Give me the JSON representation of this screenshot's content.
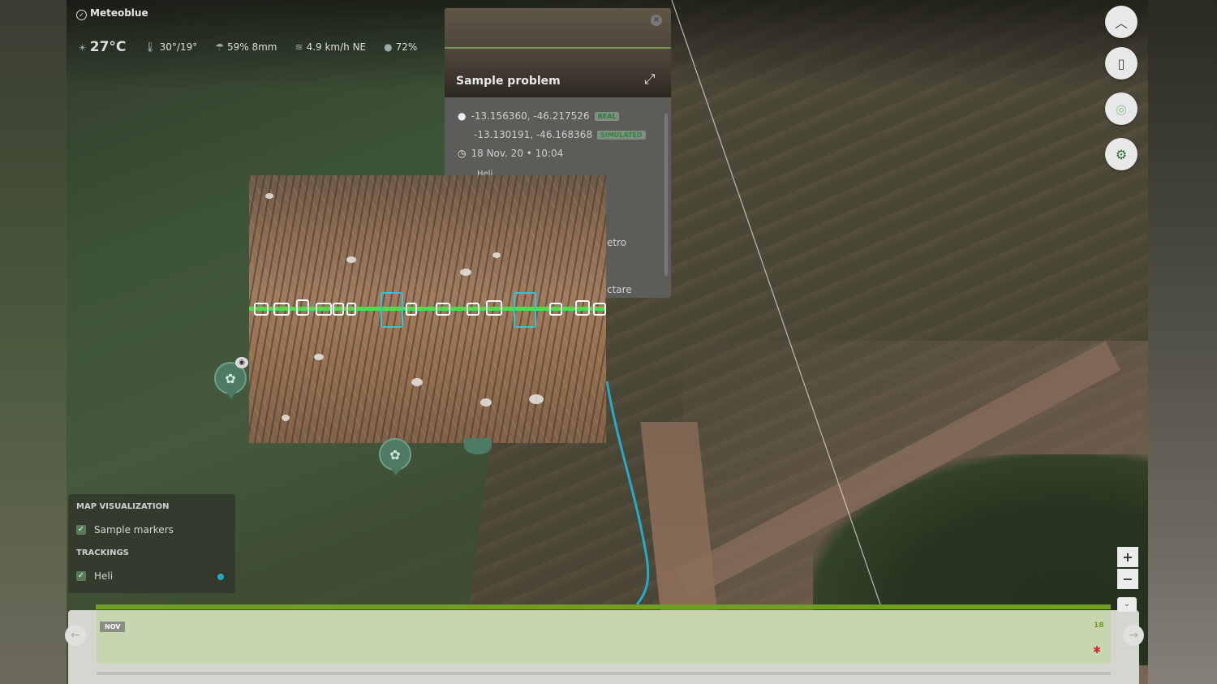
{
  "weather": {
    "brand": "Meteoblue",
    "temperature": "27°C",
    "min_max": "30°/19°",
    "precip": "59% 8mm",
    "wind": "4.9 km/h NE",
    "humidity": "72%"
  },
  "sample_panel": {
    "title": "Sample problem",
    "coord_real": "-13.156360, -46.217526",
    "coord_real_tag": "REAL",
    "coord_sim": "-13.130191, -46.168368",
    "coord_sim_tag": "SIMULATED",
    "datetime": "18 Nov. 20 • 10:04",
    "partial_1": "Heli",
    "partial_2": "etro",
    "partial_3": "ctare"
  },
  "legend": {
    "map_visualization_header": "MAP VISUALIZATION",
    "sample_markers_label": "Sample markers",
    "trackings_header": "TRACKINGS",
    "heli_label": "Heli"
  },
  "timeline": {
    "month": "NOV",
    "day": "18"
  },
  "colors": {
    "tracking_line": "#2aa8c8",
    "timeline_green": "#6f9e22",
    "detection_line": "#4be04b"
  },
  "icons": {
    "right_controls": [
      "chevron-up-icon",
      "document-icon",
      "radar-icon",
      "tractor-icon"
    ],
    "zoom": [
      "plus-icon",
      "minus-icon"
    ]
  }
}
